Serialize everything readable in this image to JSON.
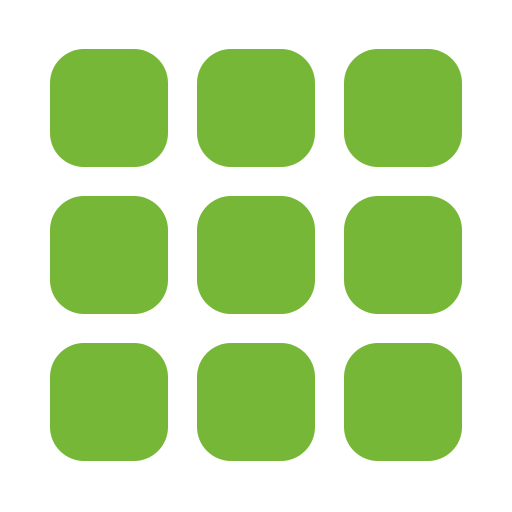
{
  "icon": {
    "name": "app-grid-icon",
    "color": "#77b737",
    "background": "#ffffff",
    "rows": 3,
    "columns": 3
  }
}
